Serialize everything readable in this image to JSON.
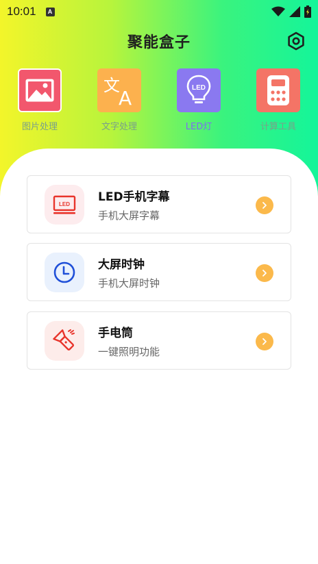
{
  "status": {
    "time": "10:01",
    "badge": "A"
  },
  "header": {
    "title": "聚能盒子"
  },
  "tools": [
    {
      "label": "图片处理",
      "icon": "image-icon",
      "color": "#f2576d"
    },
    {
      "label": "文字处理",
      "icon": "translate-icon",
      "color": "#fcb14e"
    },
    {
      "label": "LED灯",
      "icon": "led-bulb-icon",
      "color": "#8a79f0"
    },
    {
      "label": "计算工具",
      "icon": "calculator-icon",
      "color": "#f47466"
    }
  ],
  "cards": [
    {
      "title": "LED手机字幕",
      "subtitle": "手机大屏字幕",
      "icon": "led-screen-icon"
    },
    {
      "title": "大屏时钟",
      "subtitle": "手机大屏时钟",
      "icon": "clock-icon"
    },
    {
      "title": "手电筒",
      "subtitle": "一键照明功能",
      "icon": "flashlight-icon"
    }
  ],
  "colors": {
    "accent": "#fbb94b",
    "led_active": "#7f6bf2"
  }
}
